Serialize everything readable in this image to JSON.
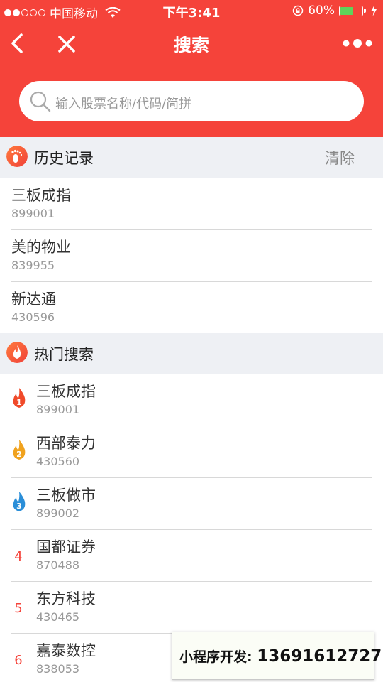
{
  "status_bar": {
    "carrier": "中国移动",
    "time": "下午3:41",
    "battery_percent": "60%",
    "battery_level": 0.6,
    "battery_color": "#5fd35a"
  },
  "nav": {
    "title": "搜索",
    "back_icon": "chevron-left-icon",
    "close_icon": "close-icon",
    "more_icon": "more-dots-icon"
  },
  "search": {
    "placeholder": "输入股票名称/代码/简拼"
  },
  "history": {
    "title": "历史记录",
    "clear_label": "清除",
    "items": [
      {
        "name": "三板成指",
        "code": "899001"
      },
      {
        "name": "美的物业",
        "code": "839955"
      },
      {
        "name": "新达通",
        "code": "430596"
      }
    ]
  },
  "hot": {
    "title": "热门搜索",
    "items": [
      {
        "rank": "1",
        "name": "三板成指",
        "code": "899001",
        "flame_color": "#f04a2a"
      },
      {
        "rank": "2",
        "name": "西部泰力",
        "code": "430560",
        "flame_color": "#f0a21e"
      },
      {
        "rank": "3",
        "name": "三板做市",
        "code": "899002",
        "flame_color": "#2a8ed8"
      },
      {
        "rank": "4",
        "name": "国都证券",
        "code": "870488"
      },
      {
        "rank": "5",
        "name": "东方科技",
        "code": "430465"
      },
      {
        "rank": "6",
        "name": "嘉泰数控",
        "code": "838053"
      }
    ]
  },
  "promo": {
    "label": "小程序开发:",
    "phone": "13691612727"
  },
  "colors": {
    "accent": "#f5433a",
    "section_bg": "#eef0f4"
  }
}
